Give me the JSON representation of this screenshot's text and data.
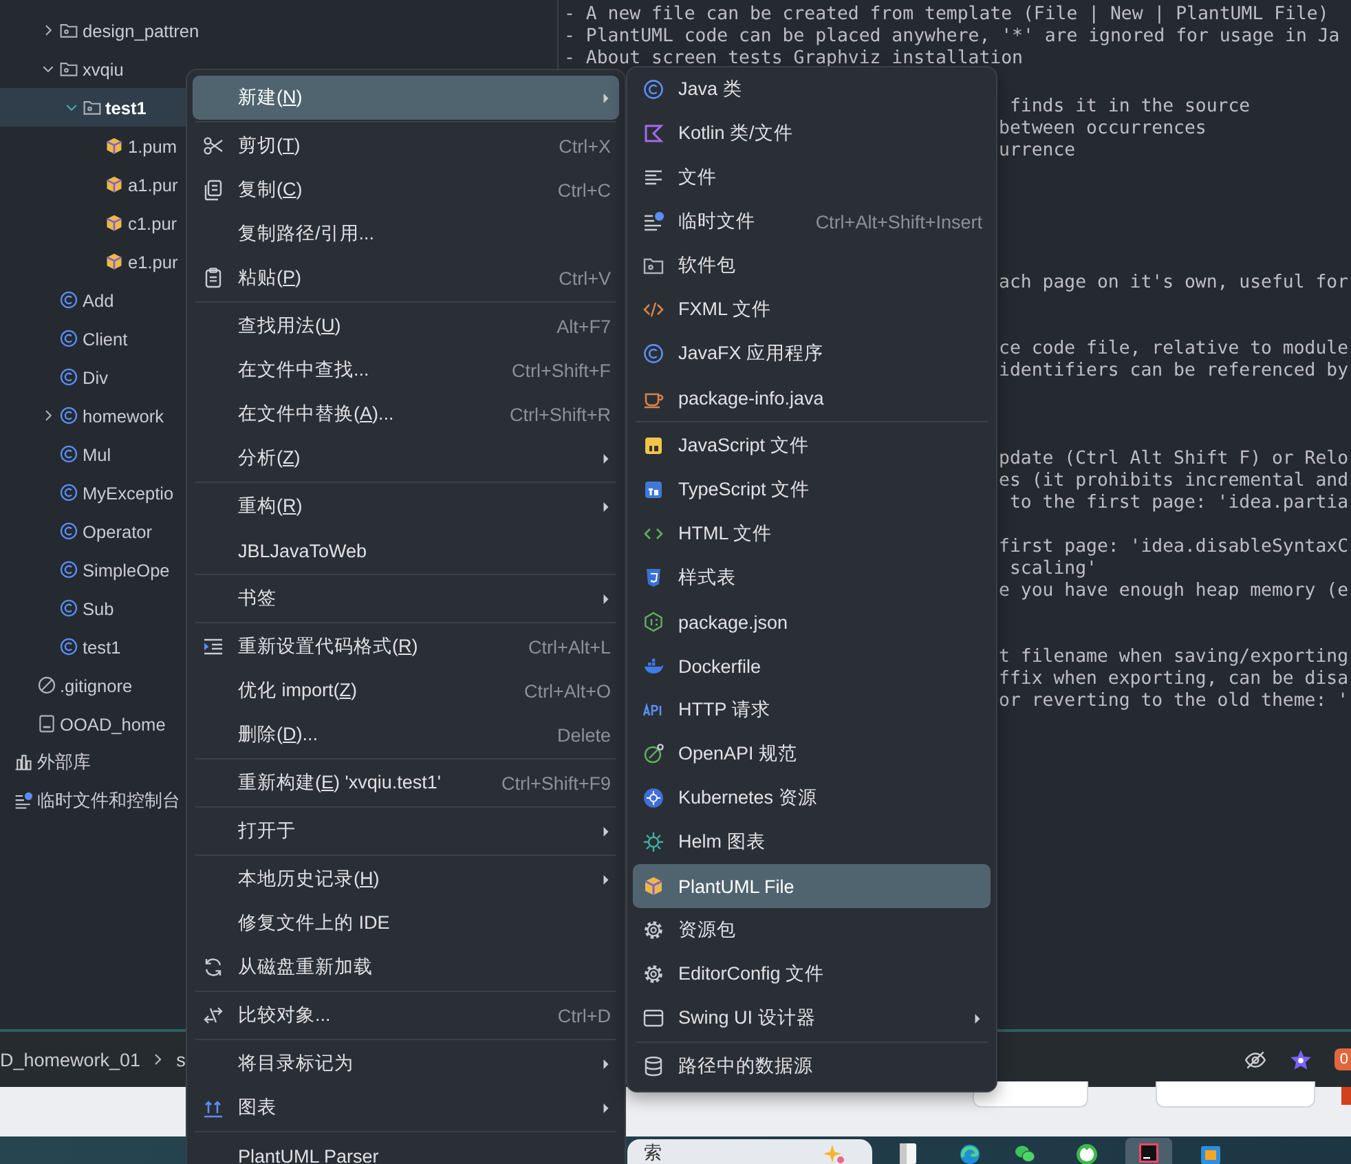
{
  "project_tree": [
    {
      "children": [
        {
          "children": [
            {
              "label": "design_pattren",
              "kind": "folder",
              "expanded": false,
              "selected": false
            },
            {
              "label": "xvqiu",
              "kind": "folder",
              "expanded": true,
              "selected": false,
              "children": [
                {
                  "label": "test1",
                  "kind": "folder",
                  "expanded": true,
                  "selected": true,
                  "children": [
                    {
                      "label": "1.pum",
                      "kind": "plantuml",
                      "selected": false
                    },
                    {
                      "label": "a1.pur",
                      "kind": "plantuml",
                      "selected": false
                    },
                    {
                      "label": "c1.pur",
                      "kind": "plantuml",
                      "selected": false
                    },
                    {
                      "label": "e1.pur",
                      "kind": "plantuml",
                      "selected": false
                    }
                  ]
                }
              ]
            },
            {
              "label": "Add",
              "kind": "class",
              "selected": false
            },
            {
              "label": "Client",
              "kind": "class",
              "selected": false
            },
            {
              "label": "Div",
              "kind": "class",
              "selected": false
            },
            {
              "label": "homework",
              "kind": "class",
              "expanded": false,
              "selected": false
            },
            {
              "label": "Mul",
              "kind": "class",
              "selected": false
            },
            {
              "label": "MyExceptio",
              "kind": "class",
              "selected": false
            },
            {
              "label": "Operator",
              "kind": "class",
              "selected": false
            },
            {
              "label": "SimpleOpe",
              "kind": "class",
              "selected": false
            },
            {
              "label": "Sub",
              "kind": "class",
              "selected": false
            },
            {
              "label": "test1",
              "kind": "class",
              "selected": false
            }
          ]
        },
        {
          "label": ".gitignore",
          "kind": "ignore_file",
          "selected": false
        },
        {
          "label": "OOAD_home",
          "kind": "module_file",
          "selected": false
        }
      ]
    },
    {
      "label": "外部库",
      "kind": "library",
      "selected": false
    },
    {
      "label": "临时文件和控制台",
      "kind": "scratches",
      "selected": false
    }
  ],
  "editor": {
    "lines": [
      "- A new file can be created from template (File | New | PlantUML File)",
      "- PlantUML code can be placed anywhere, '*' are ignored for usage in Ja",
      "- About screen tests Graphviz installation"
    ],
    "visible_fragments": [
      [
        " finds it in the source",
        "between occurrences",
        "urrence"
      ],
      [
        "ach page on it's own, useful for"
      ],
      [
        "ce code file, relative to module",
        "identifiers can be referenced by"
      ],
      [
        "pdate (Ctrl Alt Shift F) or Relo",
        "es (it prohibits incremental and",
        " to the first page: 'idea.partia"
      ],
      [
        "first page: 'idea.disableSyntaxC",
        " scaling'",
        "e you have enough heap memory (e"
      ],
      [
        "t filename when saving/exporting",
        "ffix when exporting, can be disa",
        "or reverting to the old theme: '"
      ]
    ]
  },
  "context_menu": {
    "items": [
      {
        "kind": "item",
        "label": "新建(",
        "mnemonic": "N",
        "label_rest": ")",
        "has_submenu": true,
        "selected": true
      },
      {
        "kind": "separator"
      },
      {
        "kind": "item",
        "label": "剪切(",
        "mnemonic": "T",
        "label_rest": ")",
        "shortcut": "Ctrl+X",
        "has_submenu": false,
        "selected": false
      },
      {
        "kind": "item",
        "label": "复制(",
        "mnemonic": "C",
        "label_rest": ")",
        "shortcut": "Ctrl+C",
        "has_submenu": false,
        "selected": false
      },
      {
        "kind": "item",
        "label": "复制路径/引用...",
        "has_submenu": false,
        "selected": false
      },
      {
        "kind": "item",
        "label": "粘贴(",
        "mnemonic": "P",
        "label_rest": ")",
        "shortcut": "Ctrl+V",
        "has_submenu": false,
        "selected": false
      },
      {
        "kind": "separator"
      },
      {
        "kind": "item",
        "label": "查找用法(",
        "mnemonic": "U",
        "label_rest": ")",
        "shortcut": "Alt+F7",
        "has_submenu": false,
        "selected": false
      },
      {
        "kind": "item",
        "label": "在文件中查找...",
        "shortcut": "Ctrl+Shift+F",
        "has_submenu": false,
        "selected": false
      },
      {
        "kind": "item",
        "label": "在文件中替换(",
        "mnemonic": "A",
        "label_rest": ")...",
        "shortcut": "Ctrl+Shift+R",
        "has_submenu": false,
        "selected": false
      },
      {
        "kind": "item",
        "label": "分析(",
        "mnemonic": "Z",
        "label_rest": ")",
        "has_submenu": true,
        "selected": false
      },
      {
        "kind": "separator"
      },
      {
        "kind": "item",
        "label": "重构(",
        "mnemonic": "R",
        "label_rest": ")",
        "has_submenu": true,
        "selected": false
      },
      {
        "kind": "item",
        "label": "JBLJavaToWeb",
        "has_submenu": false,
        "selected": false
      },
      {
        "kind": "separator"
      },
      {
        "kind": "item",
        "label": "书签",
        "has_submenu": true,
        "selected": false
      },
      {
        "kind": "separator"
      },
      {
        "kind": "item",
        "label": "重新设置代码格式(",
        "mnemonic": "R",
        "label_rest": ")",
        "shortcut": "Ctrl+Alt+L",
        "has_submenu": false,
        "selected": false
      },
      {
        "kind": "item",
        "label": "优化 import(",
        "mnemonic": "Z",
        "label_rest": ")",
        "shortcut": "Ctrl+Alt+O",
        "has_submenu": false,
        "selected": false
      },
      {
        "kind": "item",
        "label": "删除(",
        "mnemonic": "D",
        "label_rest": ")...",
        "shortcut": "Delete",
        "has_submenu": false,
        "selected": false
      },
      {
        "kind": "separator"
      },
      {
        "kind": "item",
        "label": "重新构建(",
        "mnemonic": "E",
        "label_rest": ") 'xvqiu.test1'",
        "shortcut": "Ctrl+Shift+F9",
        "has_submenu": false,
        "selected": false
      },
      {
        "kind": "separator"
      },
      {
        "kind": "item",
        "label": "打开于",
        "has_submenu": true,
        "selected": false
      },
      {
        "kind": "separator"
      },
      {
        "kind": "item",
        "label": "本地历史记录(",
        "mnemonic": "H",
        "label_rest": ")",
        "has_submenu": true,
        "selected": false
      },
      {
        "kind": "item",
        "label": "修复文件上的 IDE",
        "has_submenu": false,
        "selected": false
      },
      {
        "kind": "item",
        "label": "从磁盘重新加载",
        "has_submenu": false,
        "selected": false
      },
      {
        "kind": "separator"
      },
      {
        "kind": "item",
        "label": "比较对象...",
        "shortcut": "Ctrl+D",
        "has_submenu": false,
        "selected": false
      },
      {
        "kind": "separator"
      },
      {
        "kind": "item",
        "label": "将目录标记为",
        "has_submenu": true,
        "selected": false
      },
      {
        "kind": "item",
        "label": "图表",
        "has_submenu": true,
        "selected": false
      },
      {
        "kind": "separator"
      },
      {
        "kind": "item",
        "label": "PlantUML Parser",
        "has_submenu": false,
        "selected": false
      }
    ]
  },
  "new_submenu": {
    "items": [
      {
        "kind": "item",
        "label": "Java 类",
        "has_submenu": false,
        "selected": false
      },
      {
        "kind": "item",
        "label": "Kotlin 类/文件",
        "has_submenu": false,
        "selected": false
      },
      {
        "kind": "item",
        "label": "文件",
        "has_submenu": false,
        "selected": false
      },
      {
        "kind": "item",
        "label": "临时文件",
        "shortcut": "Ctrl+Alt+Shift+Insert",
        "has_submenu": false,
        "selected": false
      },
      {
        "kind": "item",
        "label": "软件包",
        "has_submenu": false,
        "selected": false
      },
      {
        "kind": "item",
        "label": "FXML 文件",
        "has_submenu": false,
        "selected": false
      },
      {
        "kind": "item",
        "label": "JavaFX 应用程序",
        "has_submenu": false,
        "selected": false
      },
      {
        "kind": "item",
        "label": "package-info.java",
        "has_submenu": false,
        "selected": false
      },
      {
        "kind": "separator"
      },
      {
        "kind": "item",
        "label": "JavaScript 文件",
        "has_submenu": false,
        "selected": false
      },
      {
        "kind": "item",
        "label": "TypeScript 文件",
        "has_submenu": false,
        "selected": false
      },
      {
        "kind": "item",
        "label": "HTML 文件",
        "has_submenu": false,
        "selected": false
      },
      {
        "kind": "item",
        "label": "样式表",
        "has_submenu": false,
        "selected": false
      },
      {
        "kind": "item",
        "label": "package.json",
        "has_submenu": false,
        "selected": false
      },
      {
        "kind": "item",
        "label": "Dockerfile",
        "has_submenu": false,
        "selected": false
      },
      {
        "kind": "item",
        "label": "HTTP 请求",
        "has_submenu": false,
        "selected": false
      },
      {
        "kind": "item",
        "label": "OpenAPI 规范",
        "has_submenu": false,
        "selected": false
      },
      {
        "kind": "item",
        "label": "Kubernetes 资源",
        "has_submenu": false,
        "selected": false
      },
      {
        "kind": "item",
        "label": "Helm 图表",
        "has_submenu": false,
        "selected": false
      },
      {
        "kind": "item",
        "label": "PlantUML File",
        "has_submenu": false,
        "selected": true
      },
      {
        "kind": "item",
        "label": "资源包",
        "has_submenu": false,
        "selected": false
      },
      {
        "kind": "item",
        "label": "EditorConfig 文件",
        "has_submenu": false,
        "selected": false
      },
      {
        "kind": "item",
        "label": "Swing UI 设计器",
        "has_submenu": true,
        "selected": false
      },
      {
        "kind": "separator"
      },
      {
        "kind": "item",
        "label": "路径中的数据源",
        "has_submenu": false,
        "selected": false
      }
    ]
  },
  "status_bar": {
    "breadcrumb": [
      "D_homework_01",
      "s"
    ],
    "badge": "0"
  },
  "taskbar": {
    "search_placeholder": "索"
  }
}
